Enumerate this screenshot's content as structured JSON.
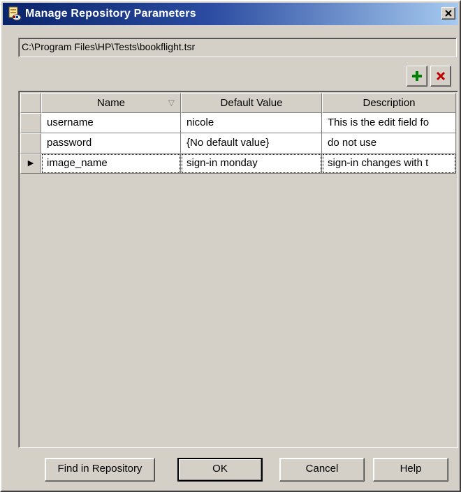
{
  "window": {
    "title": "Manage Repository Parameters",
    "icon": "repository-icon",
    "close_label": "×"
  },
  "path": {
    "value": "C:\\Program Files\\HP\\Tests\\bookflight.tsr"
  },
  "toolbar": {
    "add_icon": "plus-icon",
    "remove_icon": "x-icon",
    "add_color": "#008000",
    "remove_color": "#c00000"
  },
  "grid": {
    "columns": [
      "Name",
      "Default Value",
      "Description"
    ],
    "sort_indicator": "▽",
    "current_row_indicator": "▶",
    "rows": [
      {
        "name": "username",
        "default_value": "nicole",
        "description": "This is the edit field fo"
      },
      {
        "name": "password",
        "default_value": "{No default value}",
        "description": "do not use"
      },
      {
        "name": "image_name",
        "default_value": "sign-in monday",
        "description": "sign-in changes with t"
      }
    ]
  },
  "buttons": {
    "find": "Find in Repository",
    "ok": "OK",
    "cancel": "Cancel",
    "help": "Help"
  }
}
